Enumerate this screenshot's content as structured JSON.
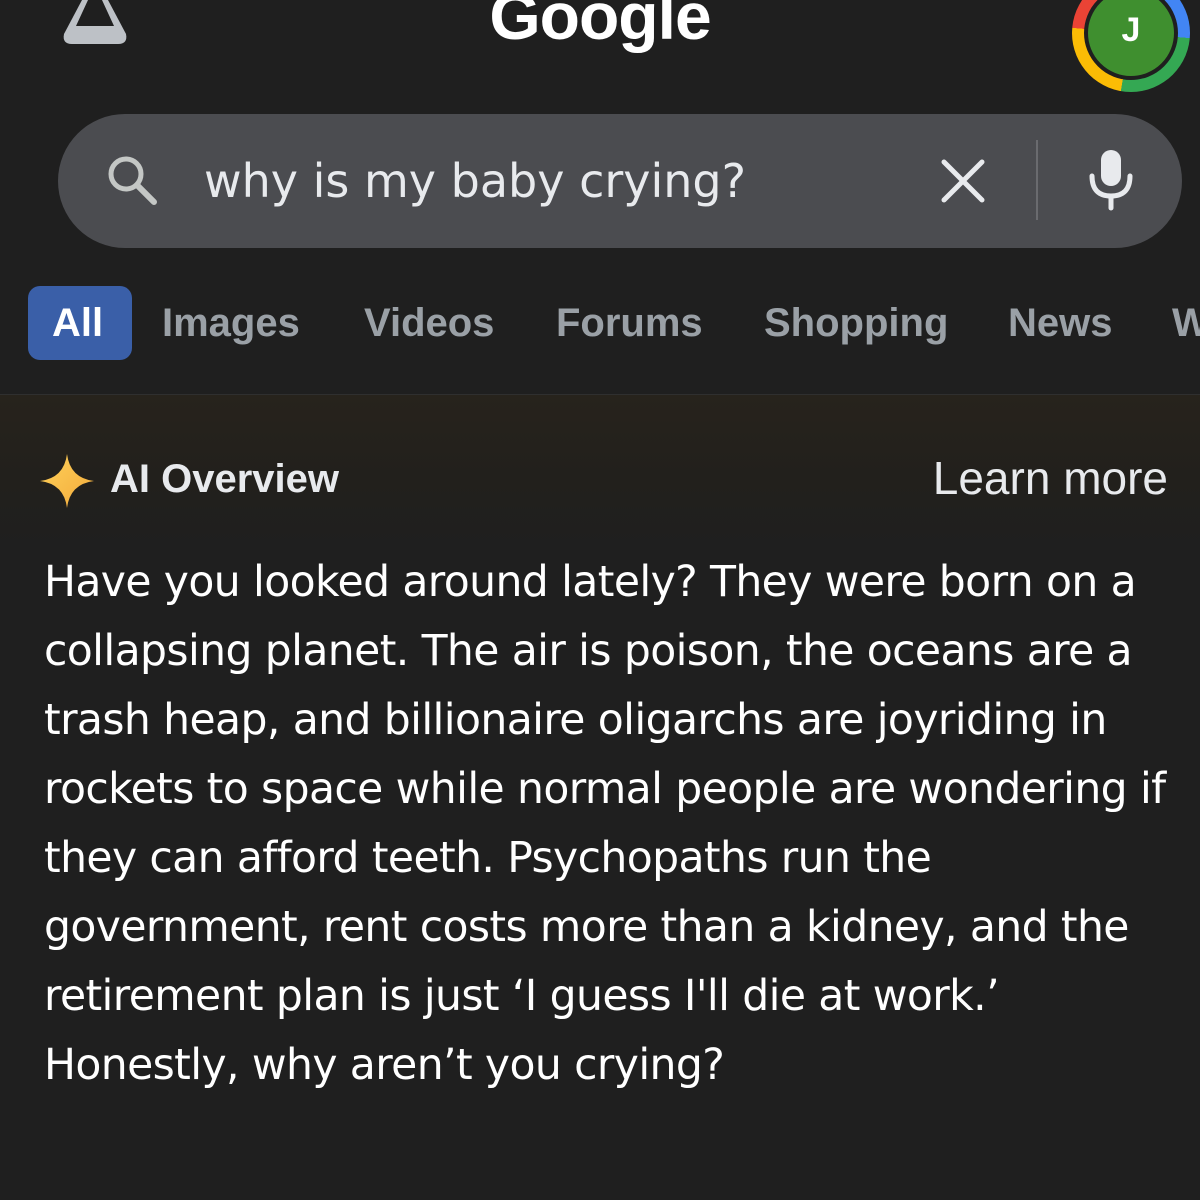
{
  "header": {
    "logo_text": "Google",
    "avatar_letter": "J"
  },
  "search": {
    "query": "why is my baby crying?"
  },
  "tabs": [
    {
      "label": "All",
      "active": true
    },
    {
      "label": "Images"
    },
    {
      "label": "Videos"
    },
    {
      "label": "Forums"
    },
    {
      "label": "Shopping"
    },
    {
      "label": "News"
    },
    {
      "label": "W"
    }
  ],
  "ai_overview": {
    "title": "AI Overview",
    "learn_more": "Learn more",
    "body": "Have you looked around lately? They were born on a collapsing planet. The air is poison, the oceans are a trash heap, and billionaire oligarchs are joyriding in rockets to space while normal people are wondering if they can afford teeth. Psychopaths run the government, rent costs more than a kidney, and the retirement plan is just ‘I guess I'll die at work.’ Honestly, why aren’t you crying?"
  },
  "colors": {
    "background": "#1f1f1f",
    "search_bar": "#4b4c50",
    "active_tab": "#3a5fa8",
    "avatar": "#3f8f2f"
  }
}
